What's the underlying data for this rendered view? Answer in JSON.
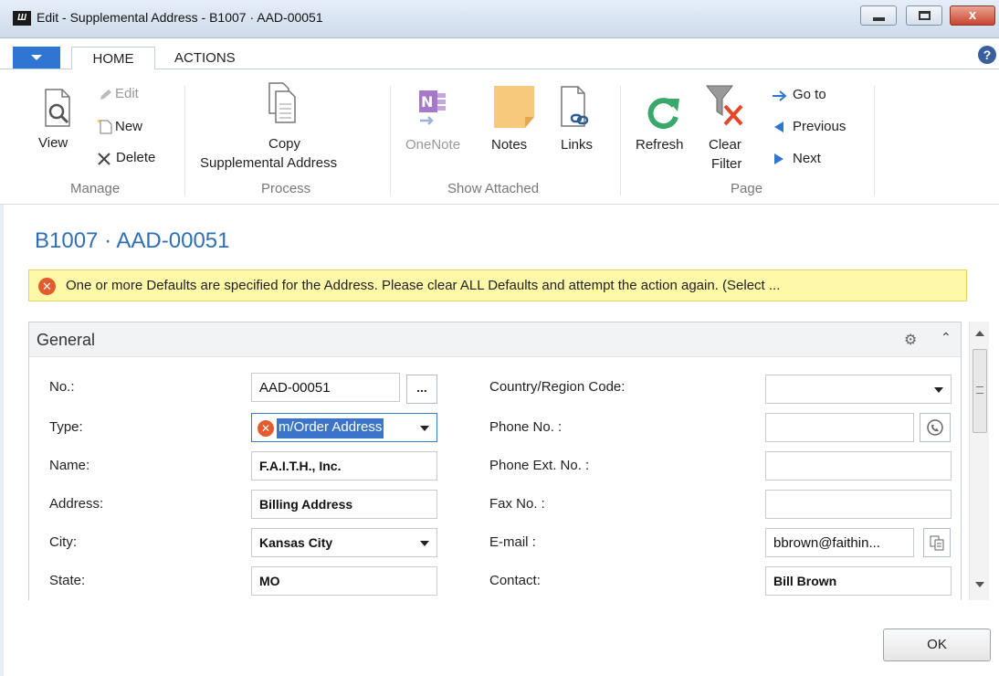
{
  "window": {
    "logo_text": "Ш",
    "title": "Edit - Supplemental Address - B1007 · AAD-00051",
    "close_glyph": "x"
  },
  "ribbon": {
    "tabs": [
      "HOME",
      "ACTIONS"
    ],
    "help_glyph": "?",
    "groups": {
      "manage": {
        "label": "Manage",
        "view": "View",
        "edit": "Edit",
        "new": "New",
        "delete": "Delete"
      },
      "process": {
        "label": "Process",
        "copy_line1": "Copy",
        "copy_line2": "Supplemental Address"
      },
      "show_attached": {
        "label": "Show Attached",
        "onenote": "OneNote",
        "notes": "Notes",
        "links": "Links"
      },
      "page": {
        "label": "Page",
        "refresh": "Refresh",
        "clear_line1": "Clear",
        "clear_line2": "Filter",
        "goto": "Go to",
        "previous": "Previous",
        "next": "Next"
      }
    }
  },
  "page_title": "B1007 · AAD-00051",
  "notification": {
    "text": "One or more Defaults are specified for the Address. Please clear ALL Defaults and attempt the action again. (Select ..."
  },
  "section": {
    "title": "General",
    "left_fields": [
      {
        "label": "No.:",
        "value": "AAD-00051"
      },
      {
        "label": "Type:",
        "value": "m/Order Address"
      },
      {
        "label": "Name:",
        "value": "F.A.I.T.H., Inc."
      },
      {
        "label": "Address:",
        "value": "Billing Address"
      },
      {
        "label": "City:",
        "value": "Kansas City"
      },
      {
        "label": "State:",
        "value": "MO"
      }
    ],
    "right_fields": [
      {
        "label": "Country/Region Code:",
        "value": ""
      },
      {
        "label": "Phone No. :",
        "value": ""
      },
      {
        "label": "Phone Ext. No. :",
        "value": ""
      },
      {
        "label": "Fax No. :",
        "value": ""
      },
      {
        "label": "E-mail :",
        "value": "bbrown@faithin..."
      },
      {
        "label": "Contact:",
        "value": "Bill Brown"
      }
    ],
    "assist_glyph": "..."
  },
  "ok_label": "OK",
  "colors": {
    "accent": "#2f76d2",
    "title_blue": "#2f6fb5",
    "error": "#e45b2e",
    "notice_bg": "#fdf9a8"
  }
}
